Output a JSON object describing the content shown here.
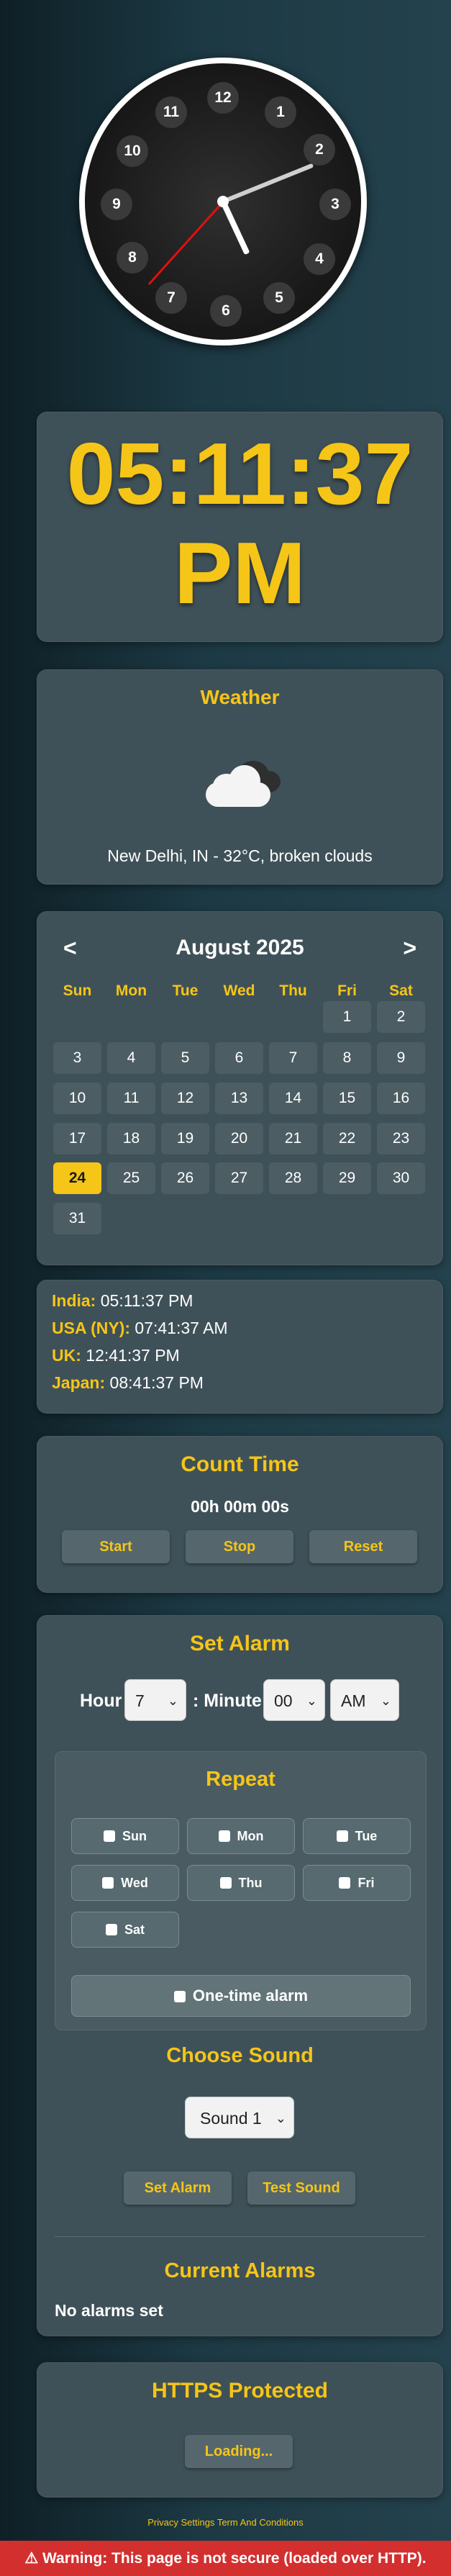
{
  "clock": {
    "numbers": [
      "12",
      "1",
      "2",
      "3",
      "4",
      "5",
      "6",
      "7",
      "8",
      "9",
      "10",
      "11"
    ],
    "time": "05:11:37"
  },
  "digital_clock": {
    "time": "05:11:37",
    "period": "PM"
  },
  "weather": {
    "title": "Weather",
    "icon": "cloud-icon",
    "description": "New Delhi, IN - 32°C, broken clouds"
  },
  "calendar": {
    "prev": "<",
    "next": ">",
    "month_label": "August 2025",
    "weekdays": [
      "Sun",
      "Mon",
      "Tue",
      "Wed",
      "Thu",
      "Fri",
      "Sat"
    ],
    "days": [
      "1",
      "2",
      "3",
      "4",
      "5",
      "6",
      "7",
      "8",
      "9",
      "10",
      "11",
      "12",
      "13",
      "14",
      "15",
      "16",
      "17",
      "18",
      "19",
      "20",
      "21",
      "22",
      "23",
      "24",
      "25",
      "26",
      "27",
      "28",
      "29",
      "30",
      "31"
    ],
    "today": "24"
  },
  "world_times": [
    {
      "city": "India:",
      "time": "05:11:37 PM"
    },
    {
      "city": "USA (NY):",
      "time": "07:41:37 AM"
    },
    {
      "city": "UK:",
      "time": "12:41:37 PM"
    },
    {
      "city": "Japan:",
      "time": "08:41:37 PM"
    }
  ],
  "count_time": {
    "title": "Count Time",
    "display": "00h 00m 00s",
    "start": "Start",
    "stop": "Stop",
    "reset": "Reset"
  },
  "alarm": {
    "title": "Set Alarm",
    "hour_label": "Hour",
    "hour_value": "7",
    "minute_label": ": Minute",
    "minute_value": "00",
    "period_value": "AM",
    "repeat_title": "Repeat",
    "repeat_days": [
      "Sun",
      "Mon",
      "Tue",
      "Wed",
      "Thu",
      "Fri",
      "Sat"
    ],
    "one_time": "One-time alarm",
    "sound_title": "Choose Sound",
    "sound_value": "Sound 1",
    "set_button": "Set Alarm",
    "test_button": "Test Sound",
    "current_title": "Current Alarms",
    "current_empty": "No alarms set"
  },
  "https": {
    "title": "HTTPS Protected",
    "button": "Loading..."
  },
  "footer": {
    "privacy": "Privacy Settings",
    "terms": "Term And Conditions"
  },
  "warning": {
    "icon": "warning-icon",
    "text": "⚠ Warning: This page is not secure (loaded over HTTP)."
  },
  "colors": {
    "accent": "#f5c518",
    "card": "#3f5158",
    "warning": "#d32f2f"
  }
}
